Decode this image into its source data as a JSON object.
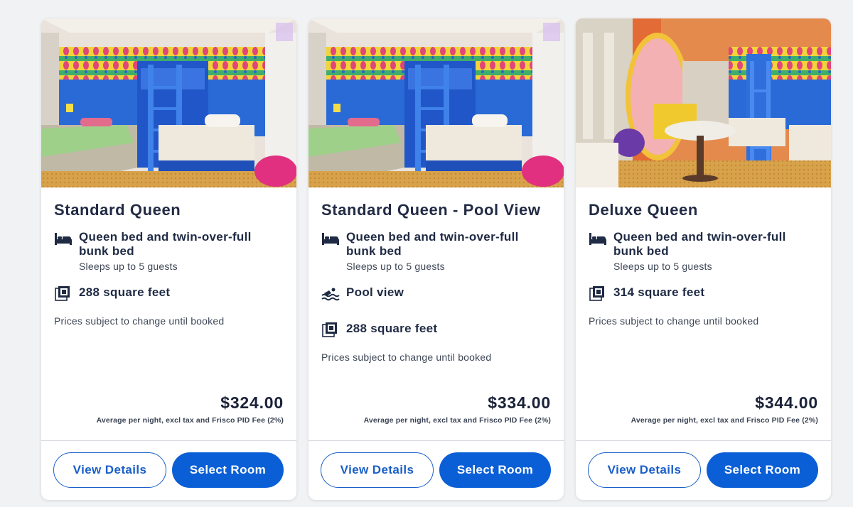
{
  "colors": {
    "accent": "#0b5fd6",
    "outline": "#1a5fc8",
    "text": "#1f2a44"
  },
  "cards": [
    {
      "title": "Standard Queen",
      "bed_text": "Queen bed and twin-over-full bunk bed",
      "sleeps": "Sleeps up to 5 guests",
      "view": "",
      "size": "288 square feet",
      "note": "Prices subject to change until booked",
      "price": "$324.00",
      "price_note": "Average per night, excl tax and Frisco PID Fee (2%)",
      "view_details": "View Details",
      "select_room": "Select Room"
    },
    {
      "title": "Standard Queen - Pool View",
      "bed_text": "Queen bed and twin-over-full bunk bed",
      "sleeps": "Sleeps up to 5 guests",
      "view": "Pool view",
      "size": "288 square feet",
      "note": "Prices subject to change until booked",
      "price": "$334.00",
      "price_note": "Average per night, excl tax and Frisco PID Fee (2%)",
      "view_details": "View Details",
      "select_room": "Select Room"
    },
    {
      "title": "Deluxe Queen",
      "bed_text": "Queen bed and twin-over-full bunk bed",
      "sleeps": "Sleeps up to 5 guests",
      "view": "",
      "size": "314 square feet",
      "note": "Prices subject to change until booked",
      "price": "$344.00",
      "price_note": "Average per night, excl tax and Frisco PID Fee (2%)",
      "view_details": "View Details",
      "select_room": "Select Room"
    }
  ],
  "icons": {
    "bed": "bed-icon",
    "size": "floor-plan-icon",
    "pool": "pool-icon"
  }
}
